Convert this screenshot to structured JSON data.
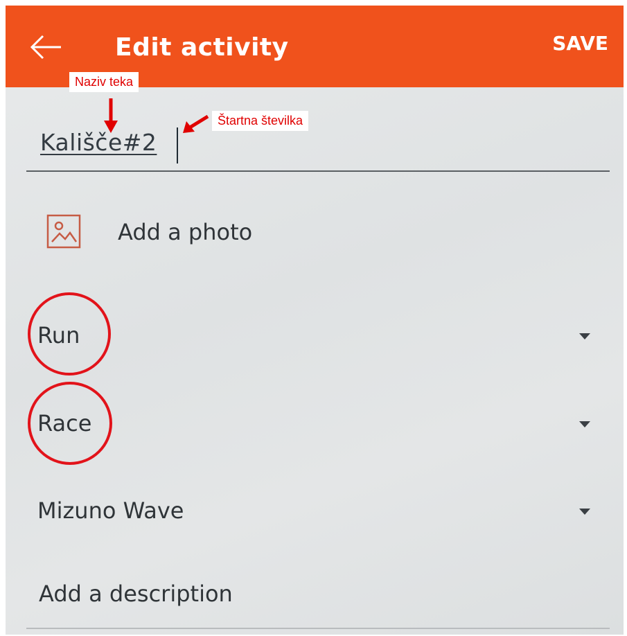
{
  "appbar": {
    "title": "Edit activity",
    "save_label": "SAVE",
    "back_icon": "arrow-left-icon",
    "background_color": "#f0521c"
  },
  "annotations": {
    "name_label": "Naziv teka",
    "number_label": "Štartna številka",
    "color": "#e00000"
  },
  "form": {
    "activity_name": "Kališče#2",
    "photo": {
      "icon": "image-icon",
      "label": "Add a photo"
    },
    "sport_type": {
      "value": "Run",
      "icon": "caret-down-icon"
    },
    "workout_type": {
      "value": "Race",
      "icon": "caret-down-icon"
    },
    "gear": {
      "value": "Mizuno Wave",
      "icon": "caret-down-icon"
    },
    "description": {
      "placeholder": "Add a description"
    }
  }
}
